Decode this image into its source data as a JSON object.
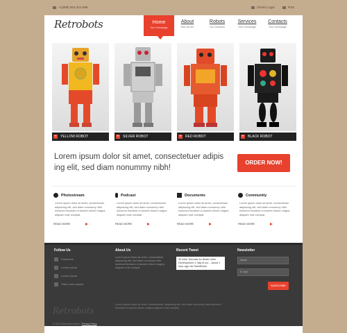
{
  "topbar": {
    "phone": "+1(999) 654-321-589",
    "login": "Clients Login",
    "rss": "RSS"
  },
  "logo": "Retrobots",
  "nav": [
    {
      "title": "Home",
      "sub": "Your Homepage"
    },
    {
      "title": "About",
      "sub": "Who we are"
    },
    {
      "title": "Robots",
      "sub": "Our Collection"
    },
    {
      "title": "Services",
      "sub": "Your Homepage"
    },
    {
      "title": "Contacts",
      "sub": "Your Homepage"
    }
  ],
  "robots": [
    {
      "caption": "YELLOW ROBOT"
    },
    {
      "caption": "SILVER ROBOT"
    },
    {
      "caption": "RED ROBOT"
    },
    {
      "caption": "BLACK ROBOT"
    }
  ],
  "slogan": "Lorem ipsum dolor sit amet, consectetuer adipis ing elit, sed diam nonummy nibh!",
  "order_label": "ORDER NOW!",
  "features": [
    {
      "title": "Photostream",
      "text": "Lorem ipsum dolor sit amet, consectetuer adipiscing elit, sed diam nonummy nibh euismod tincidunt ut laoreet dolore magna aliquam erat volutpat.",
      "more": "READ MORE"
    },
    {
      "title": "Podcast",
      "text": "Lorem ipsum dolor sit amet, consectetuer adipiscing elit, sed diam nonummy nibh euismod tincidunt ut laoreet dolore magna aliquam erat volutpat.",
      "more": "READ MORE"
    },
    {
      "title": "Documents",
      "text": "Lorem ipsum dolor sit amet, consectetuer adipiscing elit, sed diam nonummy nibh euismod tincidunt ut laoreet dolore magna aliquam erat volutpat.",
      "more": "READ MORE"
    },
    {
      "title": "Community",
      "text": "Lorem ipsum dolor sit amet, consectetuer adipiscing elit, sed diam nonummy nibh euismod tincidunt ut laoreet dolore magna aliquam erat volutpat.",
      "more": "READ MORE"
    }
  ],
  "footer": {
    "follow_title": "Follow Us",
    "follow_items": [
      "Facebook",
      "Lorem ipsum",
      "Lorem ipsum",
      "Twitt Lorem ipsum"
    ],
    "about_title": "About Us",
    "about_text": "Lorem ipsum dolor sit amet, consectetuer adipiscing elit, sed diam nonummy nibh euismod tincidunt ut laoreet dolore magna aliquam erat volutpat.",
    "tweet_title": "Recent Tweet",
    "tweet_text": "30 Web Tutorials for Better Web Development 1 http://t.co/... about 1 hour ago via TweetDeck",
    "newsletter_title": "Newsletter",
    "name_placeholder": "Name",
    "email_placeholder": "E-mail",
    "subscribe_label": "SUBSCRIBE",
    "logo": "Retrobots",
    "bottom_text": "Lorem ipsum dolor sit amet, consectetuer adipiscing elit, sed diam nonummy nibh euismod tincidunt ut laoreet dolore magna aliquam erat volutpat.",
    "copyright": "© 2011 Retrobots Orders",
    "privacy": "Privacy Policy"
  },
  "colors": {
    "accent": "#e8412d",
    "dark": "#3a3a3a",
    "background": "#c4ad8f"
  },
  "icons": {
    "phone": "phone-icon",
    "user": "user-icon",
    "rss": "rss-icon"
  }
}
